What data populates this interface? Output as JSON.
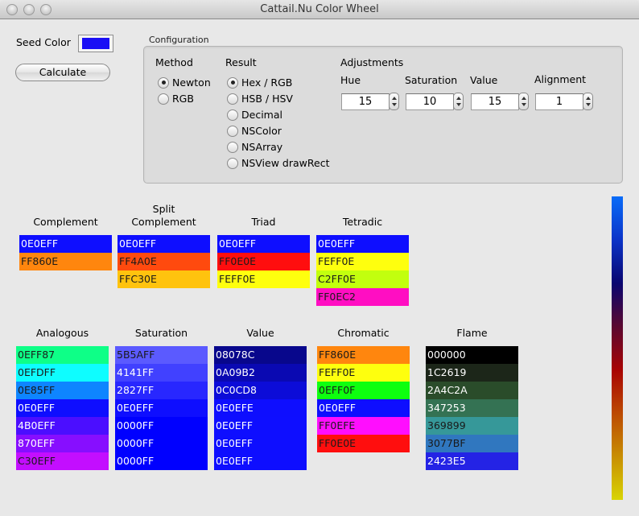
{
  "window": {
    "title": "Cattail.Nu Color Wheel",
    "controls": [
      "close",
      "minimize",
      "zoom"
    ]
  },
  "seed": {
    "label": "Seed Color",
    "color": "#1a0ef5"
  },
  "calculate_label": "Calculate",
  "configuration": {
    "title": "Configuration",
    "method": {
      "label": "Method",
      "options": [
        {
          "label": "Newton",
          "selected": true
        },
        {
          "label": "RGB",
          "selected": false
        }
      ]
    },
    "result": {
      "label": "Result",
      "options": [
        {
          "label": "Hex / RGB",
          "selected": true
        },
        {
          "label": "HSB / HSV",
          "selected": false
        },
        {
          "label": "Decimal",
          "selected": false
        },
        {
          "label": "NSColor",
          "selected": false
        },
        {
          "label": "NSArray",
          "selected": false
        },
        {
          "label": "NSView drawRect",
          "selected": false
        }
      ]
    },
    "adjustments": {
      "label": "Adjustments",
      "fields": [
        {
          "label": "Hue",
          "value": "15"
        },
        {
          "label": "Saturation",
          "value": "10"
        },
        {
          "label": "Value",
          "value": "15"
        },
        {
          "label": "Alignment",
          "value": "1"
        }
      ]
    }
  },
  "palettes": [
    {
      "title": "Complement",
      "swatches": [
        {
          "hex": "0E0EFF",
          "text": "light"
        },
        {
          "hex": "FF860E",
          "text": "dark"
        }
      ]
    },
    {
      "title": "Split\nComplement",
      "swatches": [
        {
          "hex": "0E0EFF",
          "text": "light"
        },
        {
          "hex": "FF4A0E",
          "text": "dark"
        },
        {
          "hex": "FFC30E",
          "text": "dark"
        }
      ]
    },
    {
      "title": "Triad",
      "swatches": [
        {
          "hex": "0E0EFF",
          "text": "light"
        },
        {
          "hex": "FF0E0E",
          "text": "dark"
        },
        {
          "hex": "FEFF0E",
          "text": "dark"
        }
      ]
    },
    {
      "title": "Tetradic",
      "swatches": [
        {
          "hex": "0E0EFF",
          "text": "light"
        },
        {
          "hex": "FEFF0E",
          "text": "dark"
        },
        {
          "hex": "C2FF0E",
          "text": "dark"
        },
        {
          "hex": "FF0EC2",
          "text": "dark"
        }
      ]
    },
    {
      "title": "Analogous",
      "swatches": [
        {
          "hex": "0EFF87",
          "text": "dark"
        },
        {
          "hex": "0EFDFF",
          "text": "dark"
        },
        {
          "hex": "0E85FF",
          "text": "dark"
        },
        {
          "hex": "0E0EFF",
          "text": "light"
        },
        {
          "hex": "4B0EFF",
          "text": "light"
        },
        {
          "hex": "870EFF",
          "text": "light"
        },
        {
          "hex": "C30EFF",
          "text": "dark"
        }
      ]
    },
    {
      "title": "Saturation",
      "swatches": [
        {
          "hex": "5B5AFF",
          "text": "dark"
        },
        {
          "hex": "4141FF",
          "text": "light"
        },
        {
          "hex": "2827FF",
          "text": "light"
        },
        {
          "hex": "0E0EFF",
          "text": "light"
        },
        {
          "hex": "0000FF",
          "text": "light"
        },
        {
          "hex": "0000FF",
          "text": "light"
        },
        {
          "hex": "0000FF",
          "text": "light"
        }
      ]
    },
    {
      "title": "Value",
      "swatches": [
        {
          "hex": "08078C",
          "text": "light"
        },
        {
          "hex": "0A09B2",
          "text": "light"
        },
        {
          "hex": "0C0CD8",
          "text": "light"
        },
        {
          "hex": "0E0EFE",
          "text": "light"
        },
        {
          "hex": "0E0EFF",
          "text": "light"
        },
        {
          "hex": "0E0EFF",
          "text": "light"
        },
        {
          "hex": "0E0EFF",
          "text": "light"
        }
      ]
    },
    {
      "title": "Chromatic",
      "swatches": [
        {
          "hex": "FF860E",
          "text": "dark"
        },
        {
          "hex": "FEFF0E",
          "text": "dark"
        },
        {
          "hex": "0EFF0F",
          "text": "dark"
        },
        {
          "hex": "0E0EFF",
          "text": "light"
        },
        {
          "hex": "FF0EFE",
          "text": "dark"
        },
        {
          "hex": "FF0E0E",
          "text": "dark"
        }
      ]
    },
    {
      "title": "Flame",
      "swatches": [
        {
          "hex": "000000",
          "text": "light"
        },
        {
          "hex": "1C2619",
          "text": "light"
        },
        {
          "hex": "2A4C2A",
          "text": "light"
        },
        {
          "hex": "347253",
          "text": "light"
        },
        {
          "hex": "369899",
          "text": "dark"
        },
        {
          "hex": "3077BF",
          "text": "dark"
        },
        {
          "hex": "2423E5",
          "text": "light"
        }
      ]
    }
  ],
  "gradient_bar": {
    "colors": [
      "#0a6cf8",
      "#0b34c8",
      "#0a0670",
      "#5a0830",
      "#a80404",
      "#bc4a04",
      "#c88e04",
      "#d8d404"
    ]
  }
}
